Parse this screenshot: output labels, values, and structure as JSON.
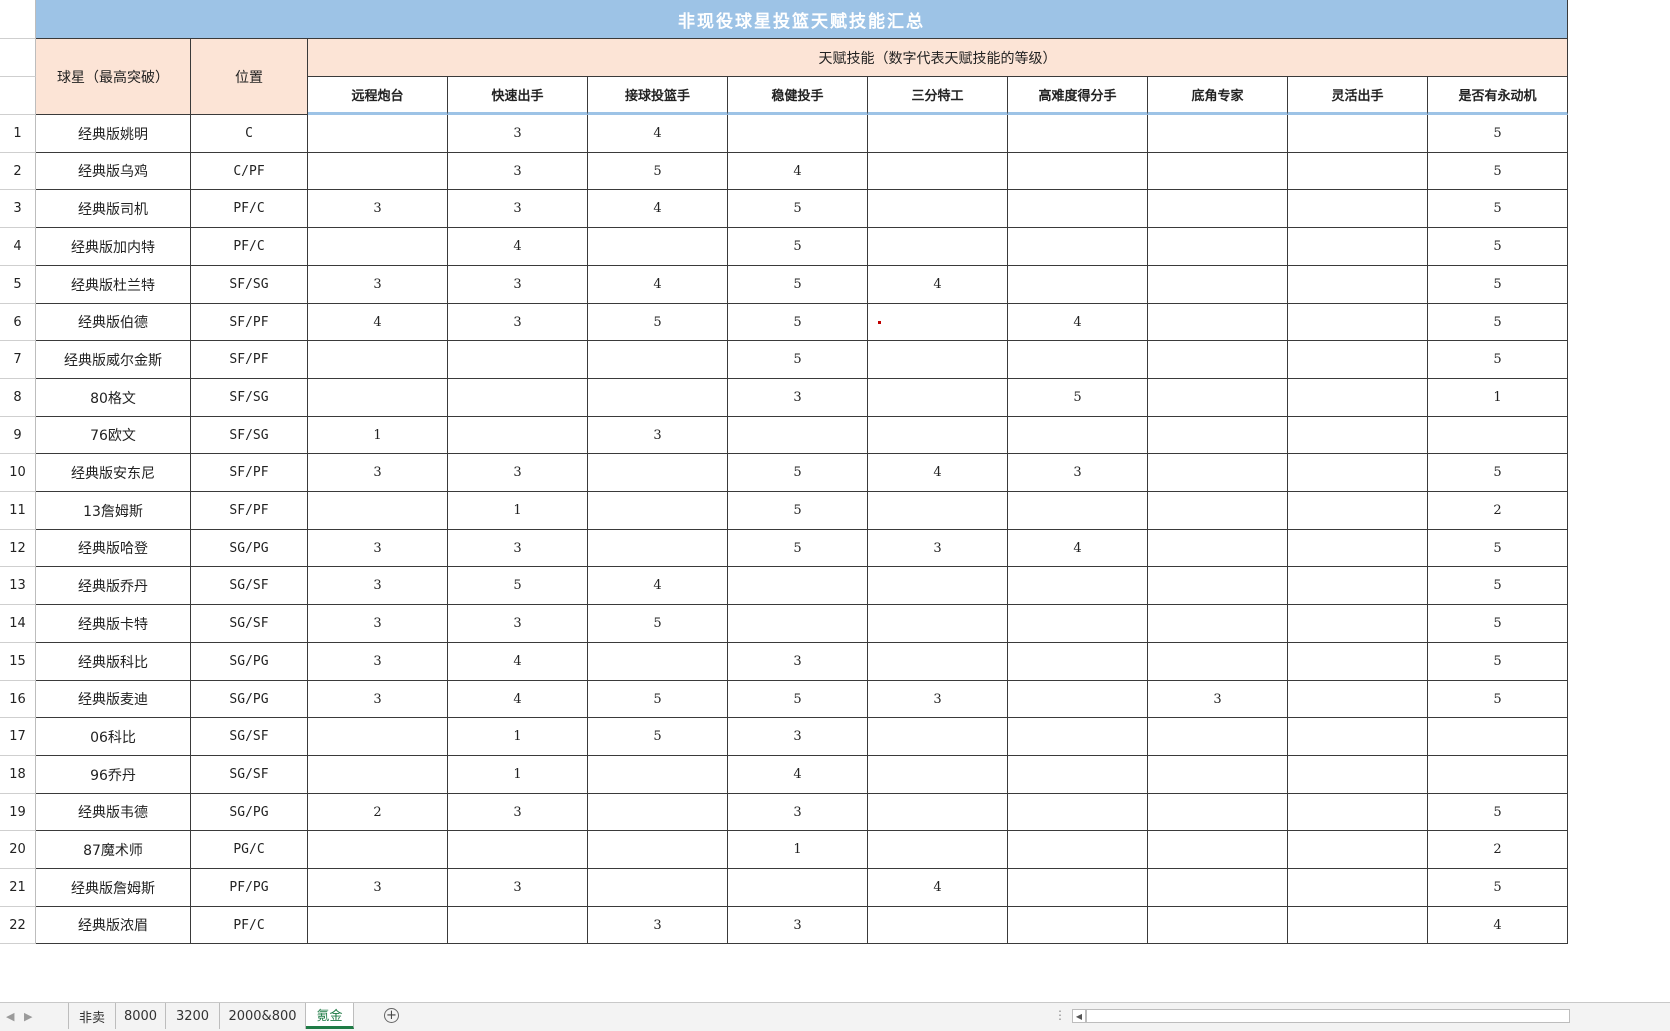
{
  "sheet": {
    "title": "非现役球星投篮天赋技能汇总",
    "player_header": "球星（最高突破）",
    "position_header": "位置",
    "skills_group_header": "天赋技能（数字代表天赋技能的等级）",
    "skill_columns": [
      "远程炮台",
      "快速出手",
      "接球投篮手",
      "稳健投手",
      "三分特工",
      "高难度得分手",
      "底角专家",
      "灵活出手",
      "是否有永动机"
    ],
    "rows": [
      {
        "num": "1",
        "name": "经典版姚明",
        "pos": "C",
        "vals": [
          "",
          "3",
          "4",
          "",
          "",
          "",
          "",
          "",
          "5"
        ]
      },
      {
        "num": "2",
        "name": "经典版乌鸡",
        "pos": "C/PF",
        "vals": [
          "",
          "3",
          "5",
          "4",
          "",
          "",
          "",
          "",
          "5"
        ]
      },
      {
        "num": "3",
        "name": "经典版司机",
        "pos": "PF/C",
        "vals": [
          "3",
          "3",
          "4",
          "5",
          "",
          "",
          "",
          "",
          "5"
        ]
      },
      {
        "num": "4",
        "name": "经典版加内特",
        "pos": "PF/C",
        "vals": [
          "",
          "4",
          "",
          "5",
          "",
          "",
          "",
          "",
          "5"
        ]
      },
      {
        "num": "5",
        "name": "经典版杜兰特",
        "pos": "SF/SG",
        "vals": [
          "3",
          "3",
          "4",
          "5",
          "4",
          "",
          "",
          "",
          "5"
        ]
      },
      {
        "num": "6",
        "name": "经典版伯德",
        "pos": "SF/PF",
        "vals": [
          "4",
          "3",
          "5",
          "5",
          "",
          "4",
          "",
          "",
          "5"
        ]
      },
      {
        "num": "7",
        "name": "经典版威尔金斯",
        "pos": "SF/PF",
        "vals": [
          "",
          "",
          "",
          "5",
          "",
          "",
          "",
          "",
          "5"
        ]
      },
      {
        "num": "8",
        "name": "80格文",
        "pos": "SF/SG",
        "vals": [
          "",
          "",
          "",
          "3",
          "",
          "5",
          "",
          "",
          "1"
        ]
      },
      {
        "num": "9",
        "name": "76欧文",
        "pos": "SF/SG",
        "vals": [
          "1",
          "",
          "3",
          "",
          "",
          "",
          "",
          "",
          ""
        ]
      },
      {
        "num": "10",
        "name": "经典版安东尼",
        "pos": "SF/PF",
        "vals": [
          "3",
          "3",
          "",
          "5",
          "4",
          "3",
          "",
          "",
          "5"
        ]
      },
      {
        "num": "11",
        "name": "13詹姆斯",
        "pos": "SF/PF",
        "vals": [
          "",
          "1",
          "",
          "5",
          "",
          "",
          "",
          "",
          "2"
        ]
      },
      {
        "num": "12",
        "name": "经典版哈登",
        "pos": "SG/PG",
        "vals": [
          "3",
          "3",
          "",
          "5",
          "3",
          "4",
          "",
          "",
          "5"
        ]
      },
      {
        "num": "13",
        "name": "经典版乔丹",
        "pos": "SG/SF",
        "vals": [
          "3",
          "5",
          "4",
          "",
          "",
          "",
          "",
          "",
          "5"
        ]
      },
      {
        "num": "14",
        "name": "经典版卡特",
        "pos": "SG/SF",
        "vals": [
          "3",
          "3",
          "5",
          "",
          "",
          "",
          "",
          "",
          "5"
        ]
      },
      {
        "num": "15",
        "name": "经典版科比",
        "pos": "SG/PG",
        "vals": [
          "3",
          "4",
          "",
          "3",
          "",
          "",
          "",
          "",
          "5"
        ]
      },
      {
        "num": "16",
        "name": "经典版麦迪",
        "pos": "SG/PG",
        "vals": [
          "3",
          "4",
          "5",
          "5",
          "3",
          "",
          "3",
          "",
          "5"
        ]
      },
      {
        "num": "17",
        "name": "06科比",
        "pos": "SG/SF",
        "vals": [
          "",
          "1",
          "5",
          "3",
          "",
          "",
          "",
          "",
          ""
        ]
      },
      {
        "num": "18",
        "name": "96乔丹",
        "pos": "SG/SF",
        "vals": [
          "",
          "1",
          "",
          "4",
          "",
          "",
          "",
          "",
          ""
        ]
      },
      {
        "num": "19",
        "name": "经典版韦德",
        "pos": "SG/PG",
        "vals": [
          "2",
          "3",
          "",
          "3",
          "",
          "",
          "",
          "",
          "5"
        ]
      },
      {
        "num": "20",
        "name": "87魔术师",
        "pos": "PG/C",
        "vals": [
          "",
          "",
          "",
          "1",
          "",
          "",
          "",
          "",
          "2"
        ]
      },
      {
        "num": "21",
        "name": "经典版詹姆斯",
        "pos": "PF/PG",
        "vals": [
          "3",
          "3",
          "",
          "",
          "4",
          "",
          "",
          "",
          "5"
        ]
      },
      {
        "num": "22",
        "name": "经典版浓眉",
        "pos": "PF/C",
        "vals": [
          "",
          "",
          "3",
          "3",
          "",
          "",
          "",
          "",
          "4"
        ]
      }
    ]
  },
  "tabs": [
    {
      "label": "非卖",
      "active": false
    },
    {
      "label": "8000",
      "active": false
    },
    {
      "label": "3200",
      "active": false
    },
    {
      "label": "2000&800",
      "active": false
    },
    {
      "label": "氪金",
      "active": true
    }
  ],
  "tabbar": {
    "add_sheet_symbol": "+",
    "nav_prev": "◀",
    "nav_next": "▶",
    "more_symbol": "⋮",
    "scroll_left_symbol": "◀"
  },
  "colors": {
    "title_bg": "#9dc3e6",
    "header_bg": "#fce4d6",
    "active_tab": "#1e7b45"
  }
}
